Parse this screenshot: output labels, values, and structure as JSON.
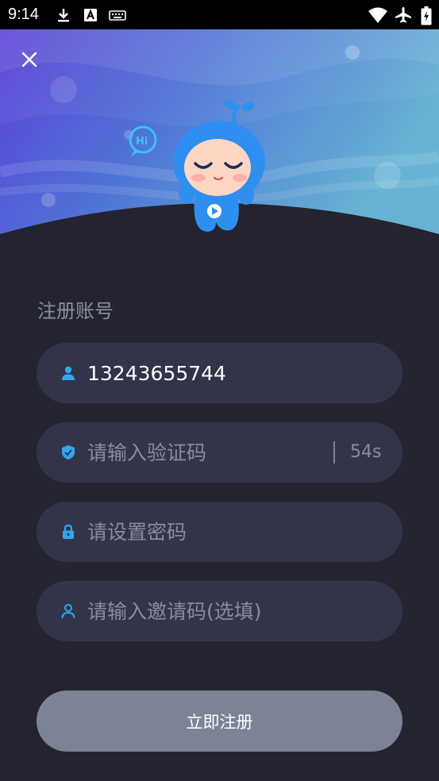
{
  "status_bar": {
    "time": "9:14",
    "left_icons": [
      "download-icon",
      "font-a-icon",
      "keyboard-icon"
    ],
    "right_icons": [
      "wifi-icon",
      "airplane-icon",
      "battery-charging-icon"
    ]
  },
  "hero": {
    "mascot_text": "Hi",
    "close_icon": "close-icon"
  },
  "form": {
    "title": "注册账号",
    "phone": {
      "value": "13243655744",
      "icon": "user-icon"
    },
    "code": {
      "placeholder": "请输入验证码",
      "countdown": "54s",
      "icon": "shield-check-icon"
    },
    "password": {
      "placeholder": "请设置密码",
      "icon": "lock-icon"
    },
    "invite": {
      "placeholder": "请输入邀请码(选填)",
      "icon": "user-outline-icon"
    },
    "submit_label": "立即注册"
  },
  "colors": {
    "background": "#23242f",
    "field_bg": "#33344a",
    "accent": "#2ea8f0",
    "button_bg": "#7c8397"
  }
}
